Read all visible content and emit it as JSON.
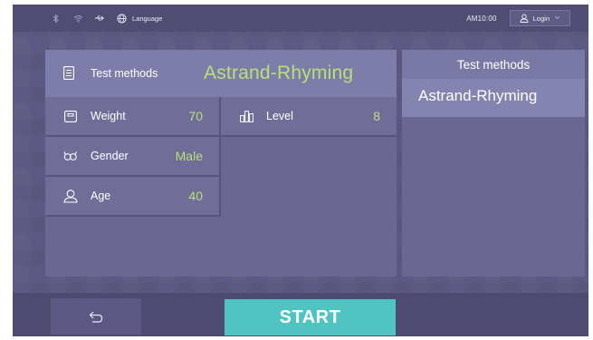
{
  "status_bar": {
    "icons": [
      "bluetooth-icon",
      "wifi-icon",
      "usb-icon",
      "globe-icon"
    ],
    "language_label": "Language",
    "time": "AM10:00",
    "login_label": "Login"
  },
  "test_method": {
    "label": "Test methods",
    "value": "Astrand-Rhyming"
  },
  "params": {
    "weight": {
      "label": "Weight",
      "value": "70"
    },
    "gender": {
      "label": "Gender",
      "value": "Male"
    },
    "age": {
      "label": "Age",
      "value": "40"
    },
    "level": {
      "label": "Level",
      "value": "8"
    }
  },
  "method_list": {
    "title": "Test methods",
    "items": [
      "Astrand-Rhyming"
    ]
  },
  "footer": {
    "start_label": "START"
  },
  "colors": {
    "accent_green": "#b8e07a",
    "start_teal": "#4fc4c0",
    "background": "#5c5a82"
  }
}
